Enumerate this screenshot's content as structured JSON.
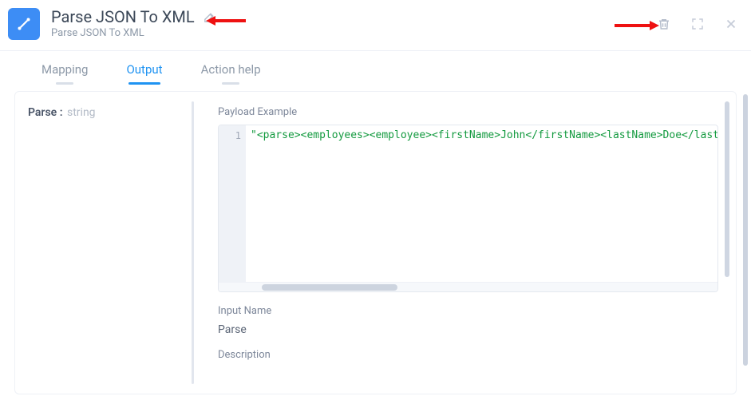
{
  "header": {
    "title": "Parse JSON To XML",
    "subtitle": "Parse JSON To XML"
  },
  "tabs": {
    "mapping": "Mapping",
    "output": "Output",
    "action_help": "Action help",
    "active": "output"
  },
  "side": {
    "name": "Parse",
    "sep": ":",
    "type": "string"
  },
  "main": {
    "payload_label": "Payload Example",
    "code_line_number": "1",
    "code_line": "\"<parse><employees><employee><firstName>John</firstName><lastName>Doe</lastName><",
    "input_name_label": "Input Name",
    "input_name_value": "Parse",
    "description_label": "Description"
  }
}
